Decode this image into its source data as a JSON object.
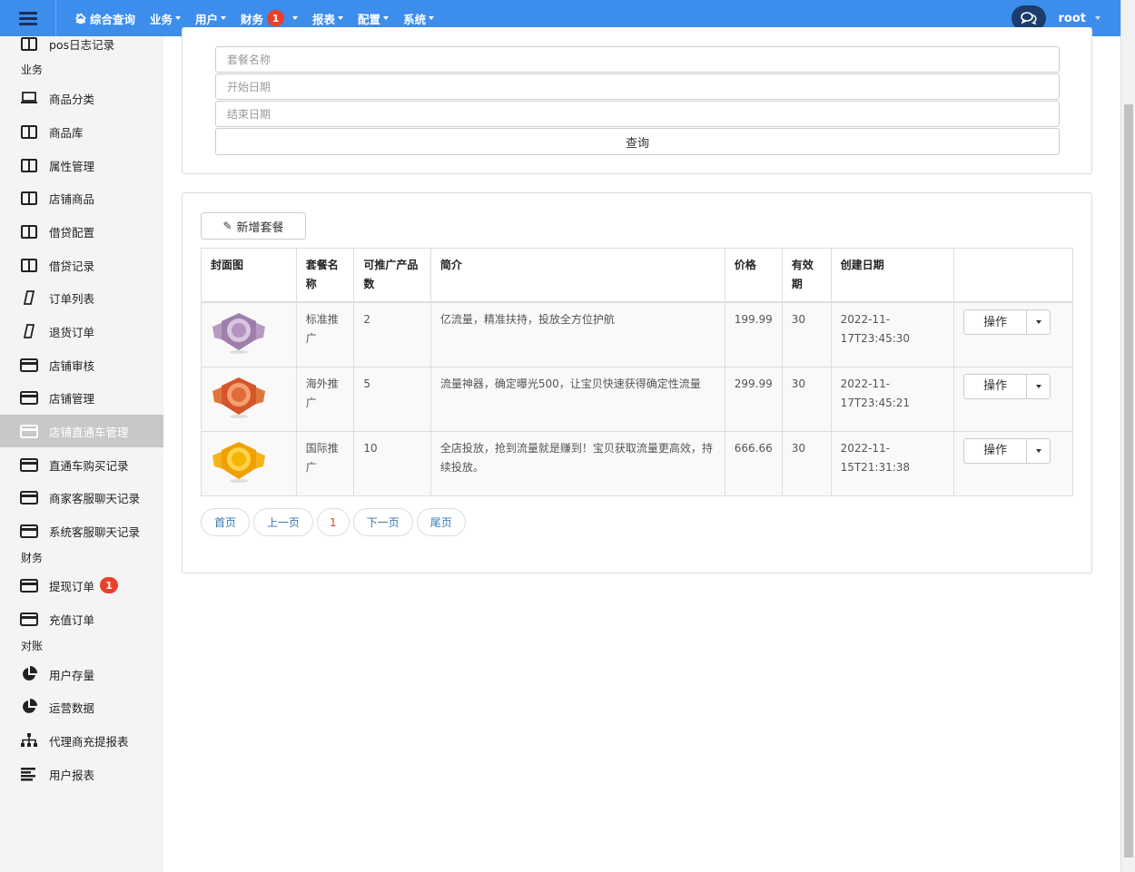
{
  "navbar": {
    "items": [
      {
        "label": "综合查询",
        "has_caret": false
      },
      {
        "label": "业务",
        "has_caret": true
      },
      {
        "label": "用户",
        "has_caret": true
      },
      {
        "label": "财务",
        "has_caret": true,
        "badge": "1"
      },
      {
        "label": "报表",
        "has_caret": true
      },
      {
        "label": "配置",
        "has_caret": true
      },
      {
        "label": "系统",
        "has_caret": true
      }
    ],
    "user": "root"
  },
  "sidebar": {
    "items": [
      {
        "label": "pos日志记录",
        "icon": "columns-icon"
      },
      {
        "group": "业务"
      },
      {
        "label": "商品分类",
        "icon": "laptop-icon"
      },
      {
        "label": "商品库",
        "icon": "columns-icon"
      },
      {
        "label": "属性管理",
        "icon": "columns-icon"
      },
      {
        "label": "店铺商品",
        "icon": "columns-icon"
      },
      {
        "label": "借贷配置",
        "icon": "columns-icon"
      },
      {
        "label": "借贷记录",
        "icon": "columns-icon"
      },
      {
        "label": "订单列表",
        "icon": "file-icon"
      },
      {
        "label": "退货订单",
        "icon": "file-icon"
      },
      {
        "label": "店铺审核",
        "icon": "credit-card-icon"
      },
      {
        "label": "店铺管理",
        "icon": "credit-card-icon"
      },
      {
        "label": "店铺直通车管理",
        "icon": "credit-card-icon",
        "active": true
      },
      {
        "label": "直通车购买记录",
        "icon": "credit-card-icon"
      },
      {
        "label": "商家客服聊天记录",
        "icon": "credit-card-icon"
      },
      {
        "label": "系统客服聊天记录",
        "icon": "credit-card-icon"
      },
      {
        "group": "财务"
      },
      {
        "label": "提现订单",
        "icon": "credit-card-icon",
        "badge": "1"
      },
      {
        "label": "充值订单",
        "icon": "credit-card-icon"
      },
      {
        "group": "对账"
      },
      {
        "label": "用户存量",
        "icon": "pie-chart-icon"
      },
      {
        "label": "运营数据",
        "icon": "pie-chart-icon"
      },
      {
        "label": "代理商充提报表",
        "icon": "sitemap-icon"
      },
      {
        "label": "用户报表",
        "icon": "align-left-icon"
      }
    ]
  },
  "search": {
    "package_name_placeholder": "套餐名称",
    "start_date_placeholder": "开始日期",
    "end_date_placeholder": "结束日期",
    "query_label": "查询"
  },
  "toolbar": {
    "add_label": "新增套餐"
  },
  "table": {
    "headers": [
      "封面图",
      "套餐名称",
      "可推广产品数",
      "简介",
      "价格",
      "有效期",
      "创建日期",
      ""
    ],
    "rows": [
      {
        "cover": "purple-medal-icon",
        "name": "标准推广",
        "products": "2",
        "intro": "亿流量，精准扶持，投放全方位护航",
        "price": "199.99",
        "validity": "30",
        "created": "2022-11-17T23:45:30",
        "action": "操作"
      },
      {
        "cover": "red-medal-icon",
        "name": "海外推广",
        "products": "5",
        "intro": "流量神器，确定曝光500，让宝贝快速获得确定性流量",
        "price": "299.99",
        "validity": "30",
        "created": "2022-11-17T23:45:21",
        "action": "操作"
      },
      {
        "cover": "gold-medal-icon",
        "name": "国际推广",
        "products": "10",
        "intro": "全店投放，抢到流量就是赚到！宝贝获取流量更高效，持续投放。",
        "price": "666.66",
        "validity": "30",
        "created": "2022-11-15T21:31:38",
        "action": "操作"
      }
    ]
  },
  "pager": {
    "first": "首页",
    "prev": "上一页",
    "current": "1",
    "next": "下一页",
    "last": "尾页"
  },
  "colors": {
    "navbar": "#3c8dec",
    "badge": "#e8412b",
    "link": "#337ab7",
    "active_sidebar": "#c8c8c8"
  }
}
